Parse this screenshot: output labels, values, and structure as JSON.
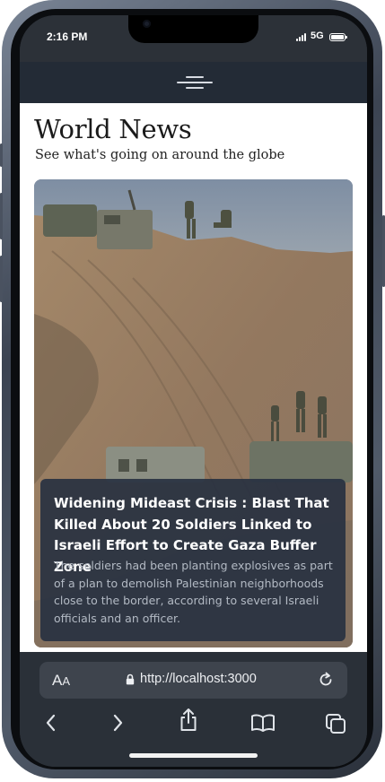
{
  "status": {
    "time": "2:16 PM",
    "network": "5G"
  },
  "page": {
    "title": "World News",
    "subtitle": "See what's going on around the globe"
  },
  "article": {
    "title": "Widening Mideast Crisis : Blast That Killed About 20 Soldiers Linked to Israeli Effort to Create Gaza Buffer Zone",
    "description": "The soldiers had been planting explosives as part of a plan to demolish Palestinian neighborhoods close to the border, according to several Israeli officials and an officer."
  },
  "browser": {
    "url": "http://localhost:3000",
    "aa_big": "A",
    "aa_small": "A"
  },
  "icons": [
    "menu-icon",
    "lock-icon",
    "reload-icon",
    "back-icon",
    "forward-icon",
    "share-icon",
    "bookmarks-icon",
    "tabs-icon",
    "signal-icon",
    "battery-icon"
  ],
  "colors": {
    "appbar": "#232b36",
    "overlay": "#263040",
    "browser": "#2a3038"
  }
}
